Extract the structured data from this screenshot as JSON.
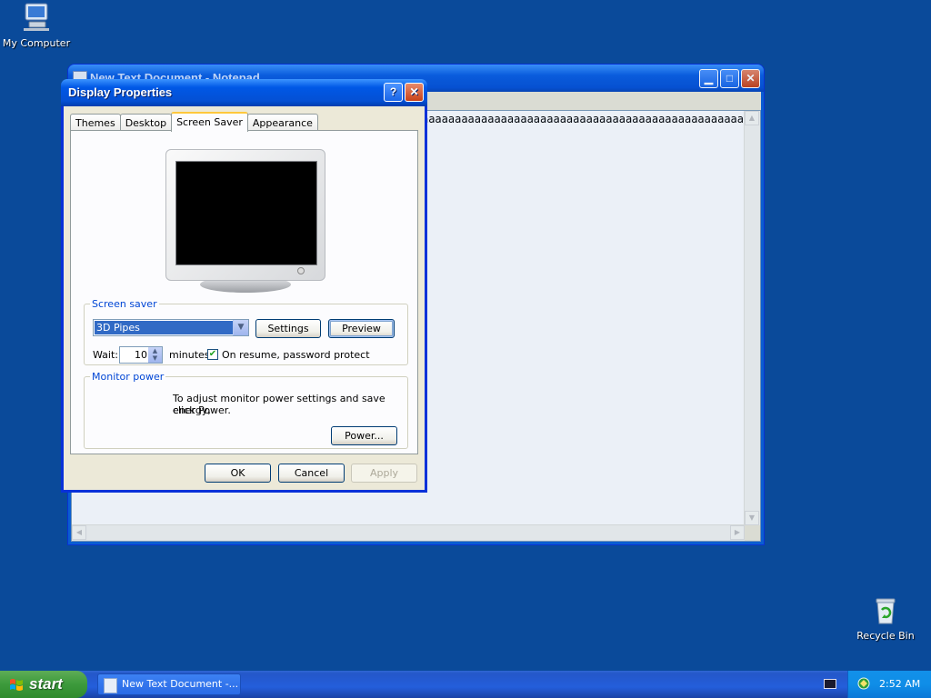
{
  "desktop": {
    "icons": [
      {
        "label": "My Computer"
      },
      {
        "label": "Recycle Bin"
      }
    ]
  },
  "notepad": {
    "title": "New Text Document - Notepad",
    "content": "aaaaaaaaaaaaaaaaaaaaaaaaaaaaaaaaaaaaaaaaaaaaaaaaaaaaaaaaaaaaaaaaaaaaaaaaaaaaaaaaaaaaaaaaaaaaaaaaaaaaaaaaaaaaaaaaaaa"
  },
  "dialog": {
    "title": "Display Properties",
    "help_button": "?",
    "tabs": [
      {
        "label": "Themes"
      },
      {
        "label": "Desktop"
      },
      {
        "label": "Screen Saver"
      },
      {
        "label": "Appearance"
      }
    ],
    "active_tab": "Screen Saver",
    "screen_saver": {
      "legend": "Screen saver",
      "selected": "3D Pipes",
      "settings_label": "Settings",
      "preview_label": "Preview",
      "wait_label": "Wait:",
      "wait_value": "10",
      "minutes_label": "minutes",
      "password_label": "On resume, password protect",
      "password_checked": true
    },
    "monitor_power": {
      "legend": "Monitor power",
      "text_line1": "To adjust monitor power settings and save energy,",
      "text_line2": "click Power.",
      "power_label": "Power..."
    },
    "ok_label": "OK",
    "cancel_label": "Cancel",
    "apply_label": "Apply"
  },
  "taskbar": {
    "start_label": "start",
    "task_label": "New Text Document -...",
    "clock": "2:52 AM"
  },
  "colors": {
    "desktop": "#0a4a9a",
    "title_bar": "#0058e6",
    "dialog_face": "#ece9d8",
    "start_green": "#3c9a3b",
    "group_legend": "#0046d5"
  }
}
